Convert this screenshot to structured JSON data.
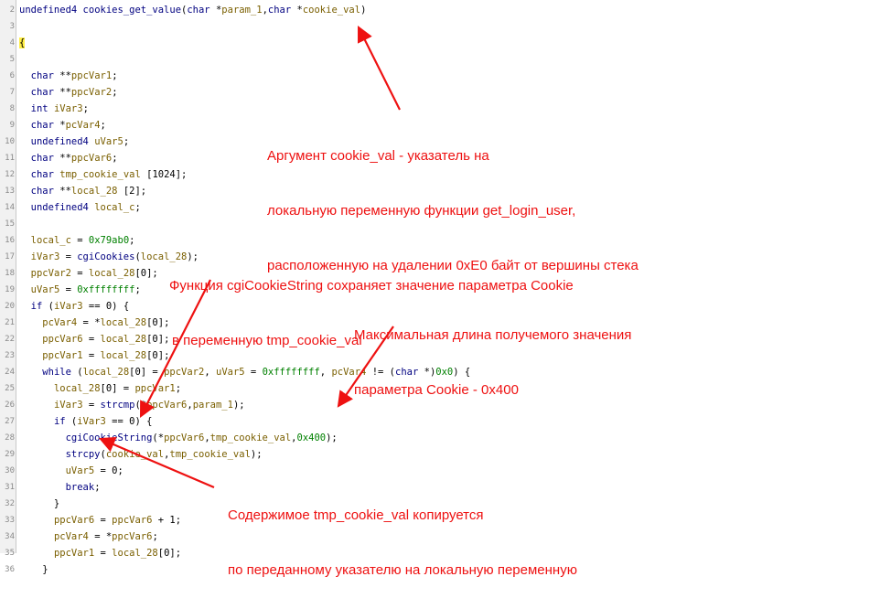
{
  "code": {
    "first_line_number": 2,
    "lines": [
      [
        [
          "t-type",
          "undefined4"
        ],
        [
          "t-plain",
          " "
        ],
        [
          "t-func",
          "cookies_get_value"
        ],
        [
          "t-plain",
          "("
        ],
        [
          "t-type",
          "char"
        ],
        [
          "t-plain",
          " *"
        ],
        [
          "t-var",
          "param_1"
        ],
        [
          "t-plain",
          ","
        ],
        [
          "t-type",
          "char"
        ],
        [
          "t-plain",
          " *"
        ],
        [
          "t-var",
          "cookie_val"
        ],
        [
          "t-plain",
          ")"
        ]
      ],
      [],
      [
        [
          "brace-hl",
          "{"
        ]
      ],
      [],
      [
        [
          "t-plain",
          "  "
        ],
        [
          "t-type",
          "char"
        ],
        [
          "t-plain",
          " **"
        ],
        [
          "t-var",
          "ppcVar1"
        ],
        [
          "t-plain",
          ";"
        ]
      ],
      [
        [
          "t-plain",
          "  "
        ],
        [
          "t-type",
          "char"
        ],
        [
          "t-plain",
          " **"
        ],
        [
          "t-var",
          "ppcVar2"
        ],
        [
          "t-plain",
          ";"
        ]
      ],
      [
        [
          "t-plain",
          "  "
        ],
        [
          "t-type",
          "int"
        ],
        [
          "t-plain",
          " "
        ],
        [
          "t-var",
          "iVar3"
        ],
        [
          "t-plain",
          ";"
        ]
      ],
      [
        [
          "t-plain",
          "  "
        ],
        [
          "t-type",
          "char"
        ],
        [
          "t-plain",
          " *"
        ],
        [
          "t-var",
          "pcVar4"
        ],
        [
          "t-plain",
          ";"
        ]
      ],
      [
        [
          "t-plain",
          "  "
        ],
        [
          "t-type",
          "undefined4"
        ],
        [
          "t-plain",
          " "
        ],
        [
          "t-var",
          "uVar5"
        ],
        [
          "t-plain",
          ";"
        ]
      ],
      [
        [
          "t-plain",
          "  "
        ],
        [
          "t-type",
          "char"
        ],
        [
          "t-plain",
          " **"
        ],
        [
          "t-var",
          "ppcVar6"
        ],
        [
          "t-plain",
          ";"
        ]
      ],
      [
        [
          "t-plain",
          "  "
        ],
        [
          "t-type",
          "char"
        ],
        [
          "t-plain",
          " "
        ],
        [
          "t-var",
          "tmp_cookie_val"
        ],
        [
          "t-plain",
          " [1024];"
        ]
      ],
      [
        [
          "t-plain",
          "  "
        ],
        [
          "t-type",
          "char"
        ],
        [
          "t-plain",
          " **"
        ],
        [
          "t-var",
          "local_28"
        ],
        [
          "t-plain",
          " [2];"
        ]
      ],
      [
        [
          "t-plain",
          "  "
        ],
        [
          "t-type",
          "undefined4"
        ],
        [
          "t-plain",
          " "
        ],
        [
          "t-var",
          "local_c"
        ],
        [
          "t-plain",
          ";"
        ]
      ],
      [],
      [
        [
          "t-plain",
          "  "
        ],
        [
          "t-var",
          "local_c"
        ],
        [
          "t-plain",
          " = "
        ],
        [
          "t-num",
          "0x79ab0"
        ],
        [
          "t-plain",
          ";"
        ]
      ],
      [
        [
          "t-plain",
          "  "
        ],
        [
          "t-var",
          "iVar3"
        ],
        [
          "t-plain",
          " = "
        ],
        [
          "t-func",
          "cgiCookies"
        ],
        [
          "t-plain",
          "("
        ],
        [
          "t-var",
          "local_28"
        ],
        [
          "t-plain",
          ");"
        ]
      ],
      [
        [
          "t-plain",
          "  "
        ],
        [
          "t-var",
          "ppcVar2"
        ],
        [
          "t-plain",
          " = "
        ],
        [
          "t-var",
          "local_28"
        ],
        [
          "t-plain",
          "[0];"
        ]
      ],
      [
        [
          "t-plain",
          "  "
        ],
        [
          "t-var",
          "uVar5"
        ],
        [
          "t-plain",
          " = "
        ],
        [
          "t-num",
          "0xffffffff"
        ],
        [
          "t-plain",
          ";"
        ]
      ],
      [
        [
          "t-plain",
          "  "
        ],
        [
          "t-kw",
          "if"
        ],
        [
          "t-plain",
          " ("
        ],
        [
          "t-var",
          "iVar3"
        ],
        [
          "t-plain",
          " == 0) {"
        ]
      ],
      [
        [
          "t-plain",
          "    "
        ],
        [
          "t-var",
          "pcVar4"
        ],
        [
          "t-plain",
          " = *"
        ],
        [
          "t-var",
          "local_28"
        ],
        [
          "t-plain",
          "[0];"
        ]
      ],
      [
        [
          "t-plain",
          "    "
        ],
        [
          "t-var",
          "ppcVar6"
        ],
        [
          "t-plain",
          " = "
        ],
        [
          "t-var",
          "local_28"
        ],
        [
          "t-plain",
          "[0];"
        ]
      ],
      [
        [
          "t-plain",
          "    "
        ],
        [
          "t-var",
          "ppcVar1"
        ],
        [
          "t-plain",
          " = "
        ],
        [
          "t-var",
          "local_28"
        ],
        [
          "t-plain",
          "[0];"
        ]
      ],
      [
        [
          "t-plain",
          "    "
        ],
        [
          "t-kw",
          "while"
        ],
        [
          "t-plain",
          " ("
        ],
        [
          "t-var",
          "local_28"
        ],
        [
          "t-plain",
          "[0] = "
        ],
        [
          "t-var",
          "ppcVar2"
        ],
        [
          "t-plain",
          ", "
        ],
        [
          "t-var",
          "uVar5"
        ],
        [
          "t-plain",
          " = "
        ],
        [
          "t-num",
          "0xffffffff"
        ],
        [
          "t-plain",
          ", "
        ],
        [
          "t-var",
          "pcVar4"
        ],
        [
          "t-plain",
          " != ("
        ],
        [
          "t-type",
          "char"
        ],
        [
          "t-plain",
          " *)"
        ],
        [
          "t-num",
          "0x0"
        ],
        [
          "t-plain",
          ") {"
        ]
      ],
      [
        [
          "t-plain",
          "      "
        ],
        [
          "t-var",
          "local_28"
        ],
        [
          "t-plain",
          "[0] = "
        ],
        [
          "t-var",
          "ppcVar1"
        ],
        [
          "t-plain",
          ";"
        ]
      ],
      [
        [
          "t-plain",
          "      "
        ],
        [
          "t-var",
          "iVar3"
        ],
        [
          "t-plain",
          " = "
        ],
        [
          "t-func",
          "strcmp"
        ],
        [
          "t-plain",
          "(*"
        ],
        [
          "t-var",
          "ppcVar6"
        ],
        [
          "t-plain",
          ","
        ],
        [
          "t-var",
          "param_1"
        ],
        [
          "t-plain",
          ");"
        ]
      ],
      [
        [
          "t-plain",
          "      "
        ],
        [
          "t-kw",
          "if"
        ],
        [
          "t-plain",
          " ("
        ],
        [
          "t-var",
          "iVar3"
        ],
        [
          "t-plain",
          " == 0) {"
        ]
      ],
      [
        [
          "t-plain",
          "        "
        ],
        [
          "t-func",
          "cgiCookieString"
        ],
        [
          "t-plain",
          "(*"
        ],
        [
          "t-var",
          "ppcVar6"
        ],
        [
          "t-plain",
          ","
        ],
        [
          "t-var",
          "tmp_cookie_val"
        ],
        [
          "t-plain",
          ","
        ],
        [
          "t-num",
          "0x400"
        ],
        [
          "t-plain",
          ");"
        ]
      ],
      [
        [
          "t-plain",
          "        "
        ],
        [
          "t-func",
          "strcpy"
        ],
        [
          "t-plain",
          "("
        ],
        [
          "t-var",
          "cookie_val"
        ],
        [
          "t-plain",
          ","
        ],
        [
          "t-var",
          "tmp_cookie_val"
        ],
        [
          "t-plain",
          ");"
        ]
      ],
      [
        [
          "t-plain",
          "        "
        ],
        [
          "t-var",
          "uVar5"
        ],
        [
          "t-plain",
          " = 0;"
        ]
      ],
      [
        [
          "t-plain",
          "        "
        ],
        [
          "t-kw",
          "break"
        ],
        [
          "t-plain",
          ";"
        ]
      ],
      [
        [
          "t-plain",
          "      }"
        ]
      ],
      [
        [
          "t-plain",
          "      "
        ],
        [
          "t-var",
          "ppcVar6"
        ],
        [
          "t-plain",
          " = "
        ],
        [
          "t-var",
          "ppcVar6"
        ],
        [
          "t-plain",
          " + 1;"
        ]
      ],
      [
        [
          "t-plain",
          "      "
        ],
        [
          "t-var",
          "pcVar4"
        ],
        [
          "t-plain",
          " = *"
        ],
        [
          "t-var",
          "ppcVar6"
        ],
        [
          "t-plain",
          ";"
        ]
      ],
      [
        [
          "t-plain",
          "      "
        ],
        [
          "t-var",
          "ppcVar1"
        ],
        [
          "t-plain",
          " = "
        ],
        [
          "t-var",
          "local_28"
        ],
        [
          "t-plain",
          "[0];"
        ]
      ],
      [
        [
          "t-plain",
          "    }"
        ]
      ]
    ]
  },
  "annotations": {
    "arg": {
      "line1": "Аргумент cookie_val - указатель на",
      "line2": "локальную переменную функции get_login_user,",
      "line3": "расположенную на удалении 0xE0 байт от вершины стека"
    },
    "func": {
      "line1": "Функция cgiCookieString сохраняет значение параметра Cookie",
      "line2": "в переменную tmp_cookie_val"
    },
    "maxlen": {
      "line1": "Максимальная длина получемого значения",
      "line2": "параметра Cookie - 0x400"
    },
    "copy": {
      "line1": "Содержимое tmp_cookie_val копируется",
      "line2": "по переданному указателю на локальную переменную"
    }
  },
  "colors": {
    "annotation_red": "#ee1111",
    "arrow_red": "#ee1111",
    "type_blue": "#000080",
    "variable_olive": "#7a5f00",
    "number_green": "#008000"
  }
}
